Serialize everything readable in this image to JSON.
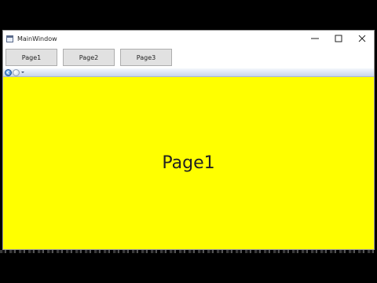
{
  "window": {
    "title": "MainWindow",
    "icon": "app-window-icon",
    "controls": [
      "minimize-icon",
      "maximize-icon",
      "close-icon"
    ]
  },
  "toolbar": {
    "buttons": [
      {
        "label": "Page1"
      },
      {
        "label": "Page2"
      },
      {
        "label": "Page3"
      }
    ]
  },
  "navigation": {
    "back_icon": "back-arrow-icon",
    "forward_icon": "forward-arrow-icon",
    "history_icon": "history-dropdown-icon"
  },
  "content": {
    "text": "Page1",
    "background_color": "#ffff00"
  },
  "colors": {
    "content_background": "#ffff00",
    "button_face": "#e1e1e1",
    "button_border": "#adadad"
  }
}
